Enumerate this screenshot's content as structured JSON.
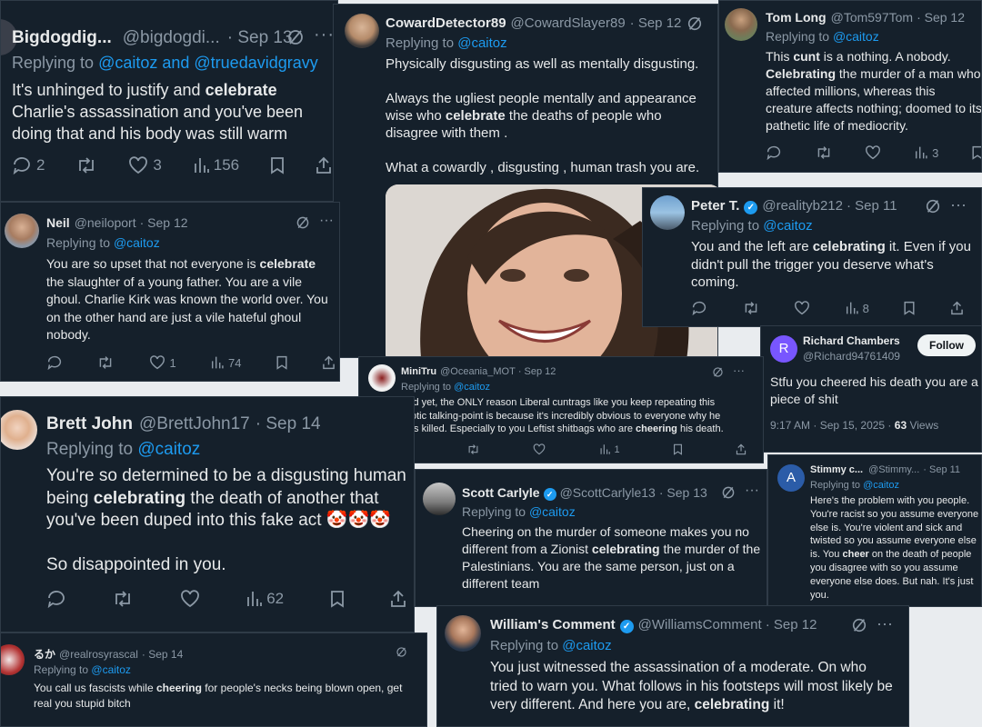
{
  "tweets": {
    "bigdog": {
      "name": "Bigdogdig...",
      "handle": "@bigdogdi...",
      "date": "· Sep 13",
      "replying_label": "Replying to",
      "reply_to": "@caitoz and @truedavidgravy",
      "body_pre": "It's unhinged to justify and ",
      "body_bold": "celebrate",
      "body_post": " Charlie's assassination and you've been doing that and his body was still warm",
      "replies": "2",
      "likes": "3",
      "views": "156"
    },
    "coward": {
      "name": "CowardDetector89",
      "handle": "@CowardSlayer89",
      "date": "· Sep 12",
      "replying_label": "Replying to",
      "reply_to": "@caitoz",
      "line1": "Physically disgusting as well as mentally disgusting.",
      "line2_pre": "Always the ugliest people mentally and appearance wise who ",
      "line2_bold": "celebrate",
      "line2_post": " the deaths of people who disagree with them .",
      "line3": "What a cowardly , disgusting , human trash you are."
    },
    "tom": {
      "name": "Tom Long",
      "handle": "@Tom597Tom",
      "date": "· Sep 12",
      "replying_label": "Replying to",
      "reply_to": "@caitoz",
      "body_a": "This ",
      "body_b": "cunt",
      "body_c": " is a nothing. A nobody. ",
      "body_d": "Celebrating",
      "body_e": " the murder of a man who affected millions, whereas this creature  affects nothing; doomed to its pathetic life of mediocrity.",
      "views": "3"
    },
    "neil": {
      "name": "Neil",
      "handle": "@neiloport",
      "date": "· Sep 12",
      "replying_label": "Replying to",
      "reply_to": "@caitoz",
      "body_pre": "You are so upset that not everyone is ",
      "body_bold": "celebrate",
      "body_post": " the slaughter of a young father. You are a vile ghoul. Charlie Kirk was known the world over. You on the other hand are just a vile hateful ghoul nobody.",
      "likes": "1",
      "views": "74"
    },
    "peter": {
      "name": "Peter T.",
      "handle": "@realityb212",
      "date": "· Sep 11",
      "replying_label": "Replying to",
      "reply_to": "@caitoz",
      "body_pre": "You and the left are ",
      "body_bold": "celebrating",
      "body_post": " it. Even if you didn't pull the trigger you deserve what's coming.",
      "views": "8"
    },
    "richard": {
      "name": "Richard Chambers",
      "handle": "@Richard94761409",
      "avatar_letter": "R",
      "follow_label": "Follow",
      "body": "Stfu you cheered his death you are a piece of shit",
      "timestamp": "9:17 AM · Sep 15, 2025 · ",
      "views_count": "63",
      "views_label": " Views"
    },
    "minitru": {
      "name": "MiniTru",
      "handle": "@Oceania_MOT",
      "date": "· Sep 12",
      "replying_label": "Replying to",
      "reply_to": "@caitoz",
      "body_pre": "And yet, the ONLY reason Liberal cuntrags like you keep repeating this idiotic talking-point is because it's incredibly obvious to everyone why he was killed.  Especially to you Leftist shitbags who are ",
      "body_bold": "cheering",
      "body_post": " his death.",
      "views": "1"
    },
    "brett": {
      "name": "Brett John",
      "handle": "@BrettJohn17",
      "date": "· Sep 14",
      "replying_label": "Replying to",
      "reply_to": "@caitoz",
      "body_pre": "You're so determined to be a disgusting human being ",
      "body_bold": "celebrating",
      "body_post": " the death of another that you've been duped into this fake act ",
      "emoji": "🤡🤡🤡",
      "body2": "So disappointed in you.",
      "views": "62"
    },
    "stimmy": {
      "name": "Stimmy c...",
      "handle": "@Stimmy...",
      "date": "· Sep 11",
      "avatar_letter": "A",
      "replying_label": "Replying to",
      "reply_to": "@caitoz",
      "body_pre": "Here's the problem with you people. You're racist so you assume everyone else is. You're violent and sick and twisted so you assume everyone else is. You ",
      "body_bold": "cheer",
      "body_post": " on the death of people you disagree with so you assume everyone else does. But nah. It's just you."
    },
    "scott": {
      "name": "Scott Carlyle",
      "handle": "@ScottCarlyle13",
      "date": "· Sep 13",
      "replying_label": "Replying to",
      "reply_to": "@caitoz",
      "body_pre": "Cheering on the murder of someone makes you no different from a Zionist ",
      "body_bold": "celebrating",
      "body_post": " the murder of the Palestinians. You are the same person, just on a different team"
    },
    "ruka": {
      "name": "るか",
      "handle": "@realrosyrascal",
      "date": "· Sep 14",
      "replying_label": "Replying to",
      "reply_to": "@caitoz",
      "body_pre": "You call us fascists while ",
      "body_bold": "cheering",
      "body_post": " for people's necks being blown open, get real you stupid bitch"
    },
    "william": {
      "name": "William's Comment",
      "handle": "@WilliamsComment",
      "date": "· Sep 12",
      "replying_label": "Replying to",
      "reply_to": "@caitoz",
      "body_pre": "You just witnessed the assassination of a moderate. On who tried to warn you. What follows in his footsteps will most likely be very different. And here you are, ",
      "body_bold": "celebrating",
      "body_post": " it!"
    }
  },
  "colors": {
    "background": "#15202b",
    "text": "#e7e9ea",
    "muted": "#8b98a5",
    "link": "#1d9bf0",
    "verified": "#1d9bf0"
  }
}
